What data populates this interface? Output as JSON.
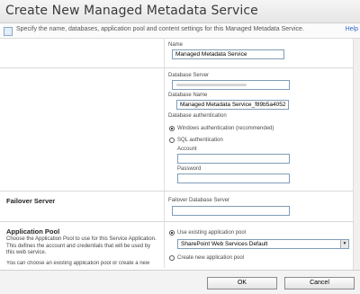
{
  "dialog": {
    "title": "Create New Managed Metadata Service",
    "description": "Specify the name, databases, application pool and content settings for this Managed Metadata Service.",
    "help_link": "Help"
  },
  "name_section": {
    "label": "Name",
    "value": "Managed Metadata Service"
  },
  "database_section": {
    "server_label": "Database Server",
    "name_label": "Database Name",
    "name_value": "Managed Metadata Service_f89b5a4052",
    "auth_label": "Database authentication",
    "windows_auth_label": "Windows authentication (recommended)",
    "sql_auth_label": "SQL authentication",
    "account_label": "Account",
    "password_label": "Password",
    "selected_auth": "windows"
  },
  "failover_section": {
    "title": "Failover Server",
    "label": "Failover Database Server"
  },
  "app_pool_section": {
    "title": "Application Pool",
    "description": "Choose the Application Pool to use for this Service Application. This defines the account and credentials that will be used by this web service.",
    "description2": "You can choose an existing application pool or create a new one.",
    "use_existing_label": "Use existing application pool",
    "selected_pool": "SharePoint Web Services Default",
    "create_new_label": "Create new application pool",
    "selected_option": "existing"
  },
  "footer": {
    "ok_label": "OK",
    "cancel_label": "Cancel"
  }
}
